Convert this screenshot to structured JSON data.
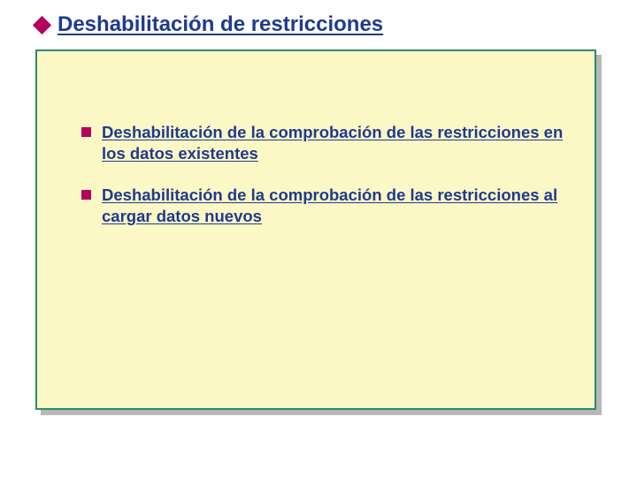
{
  "title": "Deshabilitación de restricciones",
  "bullets": [
    "Deshabilitación de la comprobación de las restricciones en los datos existentes",
    "Deshabilitación de la comprobación de las restricciones al cargar datos nuevos"
  ]
}
